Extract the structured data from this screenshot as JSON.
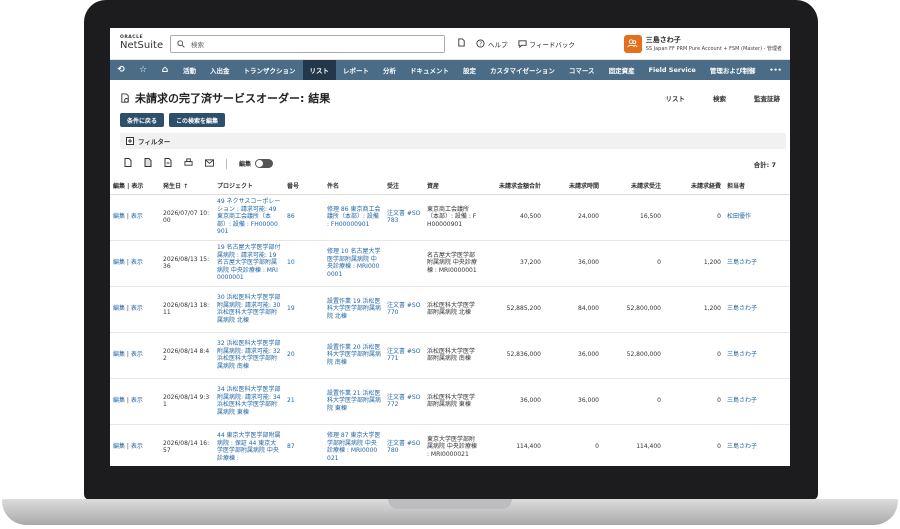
{
  "header": {
    "logo_top": "ORACLE",
    "logo_main": "NetSuite",
    "search_placeholder": "検索",
    "help": "ヘルプ",
    "feedback": "フィードバック",
    "user_initials": "三",
    "user_name": "三島さわ子",
    "user_role": "SS Japan FF PRM Pure Account + FSM (Master) - 管理者"
  },
  "nav": [
    "活動",
    "入出金",
    "トランザクション",
    "リスト",
    "レポート",
    "分析",
    "ドキュメント",
    "設定",
    "カスタマイゼーション",
    "コマース",
    "固定資産",
    "Field Service",
    "管理および制御",
    "•••"
  ],
  "page": {
    "title": "未請求の完了済サービスオーダー: 結果",
    "link_list": "リスト",
    "link_search": "検索",
    "link_audit": "監査証跡",
    "btn_back": "条件に戻る",
    "btn_edit": "この検索を編集",
    "filter_label": "フィルター",
    "edit_toggle_label": "編集",
    "total": "合計: 7"
  },
  "table": {
    "headers": [
      "編集 | 表示",
      "発生日 ↑",
      "プロジェクト",
      "番号",
      "件名",
      "受注",
      "資産",
      "未請求金額合計",
      "未請求時間",
      "未請求受注",
      "未請求経費",
      "担当者"
    ],
    "rows": [
      {
        "date": "2026/07/07 10:00",
        "project": "49 ネクサスコーポレーション : 請求可能: 49 東京商工会議所（本部）: 設備 : FH00000901",
        "number": "86",
        "subject": "修理 86 東京商工会議所（本部）: 設備 : FH00000901",
        "order": "注文書 #SO783",
        "asset": "東京商工会議所（本部）: 設備 : FH00000901",
        "total": "40,500",
        "hours": "24,000",
        "unbilled_order": "16,500",
        "expenses": "0",
        "owner": "松田優作"
      },
      {
        "date": "2026/08/13 15:36",
        "project": "19 名古屋大学医学部付属病院 : 請求可能: 19 名古屋大学医学部附属病院 中央診療棟 : MRI0000001",
        "number": "10",
        "subject": "修理 10 名古屋大学医学部附属病院 中央診療棟 : MRI0000001",
        "order": "",
        "asset": "名古屋大学医学部附属病院 中央診療棟 : MRI0000001",
        "total": "37,200",
        "hours": "36,000",
        "unbilled_order": "0",
        "expenses": "1,200",
        "owner": "三島さわ子"
      },
      {
        "date": "2026/08/13 18:11",
        "project": "30 浜松医科大学医学部附属病院: 請求可能: 30 浜松医科大学医学部附属病院 北棟",
        "number": "19",
        "subject": "設置作業 19 浜松医科大学医学部附属病院 北棟",
        "order": "注文書 #SO770",
        "asset": "浜松医科大学医学部附属病院 北棟",
        "total": "52,885,200",
        "hours": "84,000",
        "unbilled_order": "52,800,000",
        "expenses": "1,200",
        "owner": "三島さわ子"
      },
      {
        "date": "2026/08/14 8:42",
        "project": "32 浜松医科大学医学部附属病院: 請求可能: 32 浜松医科大学医学部附属病院 南棟",
        "number": "20",
        "subject": "設置作業 20 浜松医科大学医学部附属病院 南棟",
        "order": "注文書 #SO771",
        "asset": "浜松医科大学医学部附属病院 南棟",
        "total": "52,836,000",
        "hours": "36,000",
        "unbilled_order": "52,800,000",
        "expenses": "0",
        "owner": "三島さわ子"
      },
      {
        "date": "2026/08/14 9:31",
        "project": "34 浜松医科大学医学部附属病院: 請求可能: 34 浜松医科大学医学部附属病院 東棟",
        "number": "21",
        "subject": "設置作業 21 浜松医科大学医学部附属病院 東棟",
        "order": "注文書 #SO772",
        "asset": "浜松医科大学医学部附属病院 東棟",
        "total": "36,000",
        "hours": "36,000",
        "unbilled_order": "0",
        "expenses": "0",
        "owner": "三島さわ子"
      },
      {
        "date": "2026/08/14 16:57",
        "project": "44 東京大学医学部附属病院 : 保証 44 東京大学医学部附属病院 中央診療棟 :",
        "number": "87",
        "subject": "修理 87 東京大学医学部附属病院 中央診療棟 : MRI0000021",
        "order": "注文書 #SO780",
        "asset": "東京大学医学部附属病院 中央診療棟 : MRI0000021",
        "total": "114,400",
        "hours": "0",
        "unbilled_order": "114,400",
        "expenses": "0",
        "owner": "三島さわ子"
      }
    ],
    "edit_label": "編集",
    "view_label": "表示",
    "separator": " | "
  }
}
